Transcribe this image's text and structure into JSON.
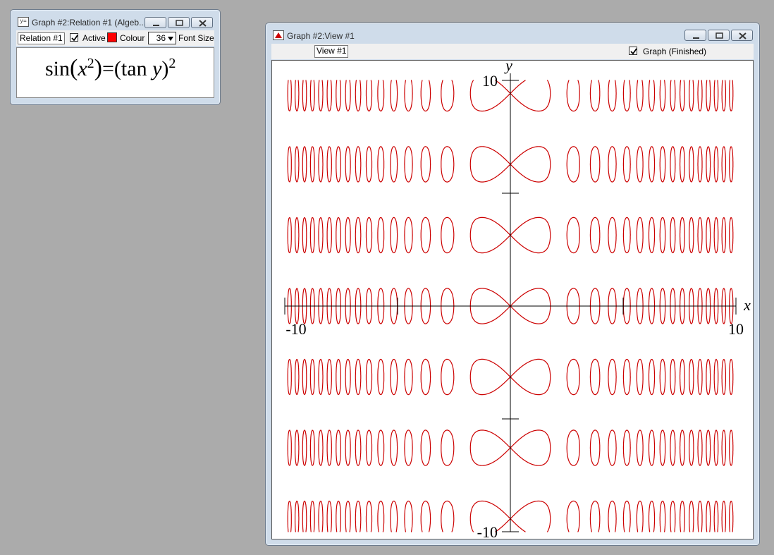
{
  "relation_window": {
    "title": "Graph #2:Relation #1 (Algeb...",
    "icon": "relation-app-icon",
    "tab_label": "Relation #1",
    "active_label": "Active",
    "active_checked": true,
    "colour_label": "Colour",
    "colour_value": "#ff0000",
    "font_size_value": "36",
    "font_size_label": "Font Size",
    "formula": {
      "f1": "sin",
      "f2": "(",
      "f3": "x",
      "f4": "2",
      "f5": ")",
      "f6": "=",
      "f7": "(tan ",
      "f8": "y",
      "f9": ")",
      "f10": "2"
    }
  },
  "view_window": {
    "title": "Graph #2:View #1",
    "icon": "graph-app-icon",
    "tab_label": "View #1",
    "graph_checked": true,
    "graph_label": "Graph (Finished)"
  },
  "graph": {
    "x_label": "x",
    "y_label": "y",
    "x_min_label": "-10",
    "x_max_label": "10",
    "y_max_label": "10",
    "y_min_label": "-10",
    "curve_color": "#cc0000",
    "axis_color": "#000000"
  },
  "chart_data": {
    "type": "scatter",
    "relation": "sin(x^2)=(tan y)^2",
    "xlim": [
      -10,
      10
    ],
    "ylim": [
      -10,
      10
    ],
    "xlabel": "x",
    "ylabel": "y",
    "grid": false
  }
}
